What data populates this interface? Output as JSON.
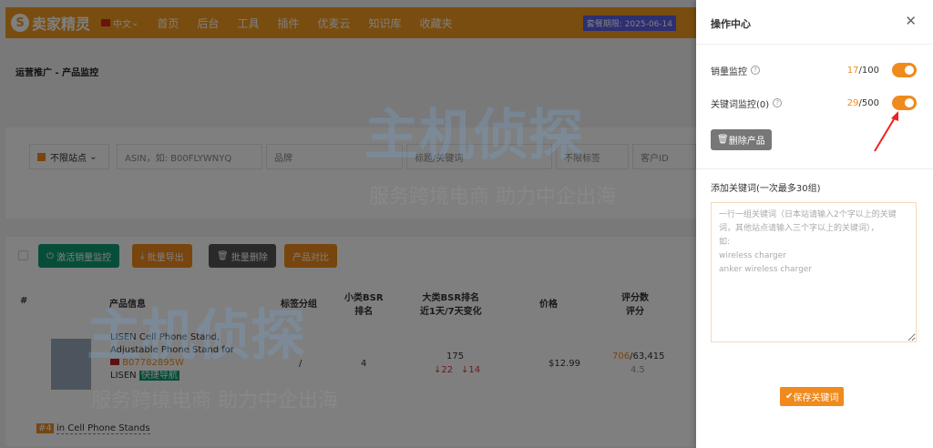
{
  "header": {
    "logo": "卖家精灵",
    "lang": "中文",
    "nav": [
      "首页",
      "后台",
      "工具",
      "插件",
      "优麦云",
      "知识库",
      "收藏夹"
    ],
    "expire": "套餐期限: 2025-06-14"
  },
  "breadcrumb": "运营推广 - 产品监控",
  "filters": {
    "site": "不限站点",
    "asin_placeholder": "ASIN，如: B00FLYWNYQ",
    "brand_placeholder": "品牌",
    "keyword_placeholder": "标题/关键词",
    "tag": "不限标签",
    "customer_placeholder": "客户ID"
  },
  "actions": {
    "activate": "激活销量监控",
    "export": "批量导出",
    "delete": "批量删除",
    "compare": "产品对比"
  },
  "table": {
    "headers": {
      "index": "#",
      "product": "产品信息",
      "tag": "标签分组",
      "small_bsr": "小类BSR",
      "small_bsr2": "排名",
      "big_bsr": "大类BSR排名",
      "big_bsr2": "近1天/7天变化",
      "price": "价格",
      "rating": "评分数",
      "rating2": "评分"
    },
    "rows": [
      {
        "title1": "LISEN Cell Phone Stand,",
        "title2": "Adjustable Phone Stand for",
        "asin": "B07782895W",
        "brand": "LISEN",
        "nav_badge": "快捷导航",
        "tag": "/",
        "small_bsr": "4",
        "big_bsr": "175",
        "change1": "22",
        "change7": "14",
        "price": "$12.99",
        "rating_count_hl": "706",
        "rating_count": "/63,415",
        "rating": "4.5",
        "rank_badge": "#4",
        "category": "in Cell Phone Stands"
      }
    ]
  },
  "drawer": {
    "title": "操作中心",
    "sales_label": "销量监控",
    "sales_used": "17",
    "sales_total": "/100",
    "kw_label": "关键词监控(0)",
    "kw_used": "29",
    "kw_total": "/500",
    "delete_btn": "删除产品",
    "add_label": "添加关键词(一次最多30组)",
    "textarea_placeholder": "一行一组关键词（日本站请输入2个字以上的关键词，其他站点请输入三个字以上的关键词），\n如:\nwireless charger\nanker wireless charger",
    "save_btn": "保存关键词"
  },
  "watermark": {
    "brand": "主机侦探",
    "slogan": "服务跨境电商 助力中企出海"
  },
  "colors": {
    "accent": "#f08a1c",
    "green": "#0f9d75",
    "dark": "#555"
  }
}
